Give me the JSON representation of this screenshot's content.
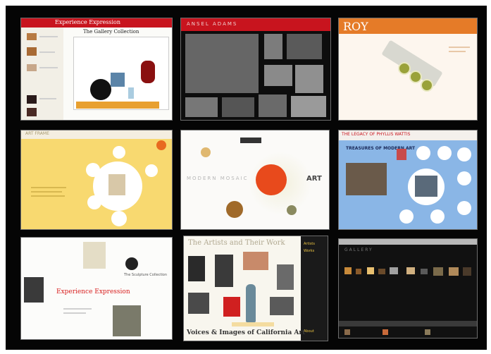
{
  "tiles": {
    "t1": {
      "header_text": "Experience Expression",
      "title": "The Gallery Collection"
    },
    "t2": {
      "header_text": "ANSEL ADAMS"
    },
    "t3": {
      "logo": "ROY"
    },
    "t4": {
      "header_text": "ART FRAME"
    },
    "t5": {
      "banner": "ART",
      "left_text": "MODERN  MOSAIC",
      "right_text": "ART"
    },
    "t6": {
      "title": "THE LEGACY OF PHYLLIS WATTIS",
      "subtitle": "TREASURES OF MODERN ART"
    },
    "t7": {
      "caption": "Experience Expression",
      "note": "The Sculpture Collection"
    },
    "t8": {
      "title": "The Artists and Their Work",
      "footer": "Voices & Images of California Art",
      "menu": [
        "Artists",
        "Works",
        "About"
      ]
    },
    "t9": {
      "title": "GALLERY"
    }
  },
  "colors": {
    "background": "#050505",
    "red": "#c8141e",
    "orange": "#e57b28",
    "yellow": "#f8d970",
    "blue": "#8ab6e6"
  }
}
